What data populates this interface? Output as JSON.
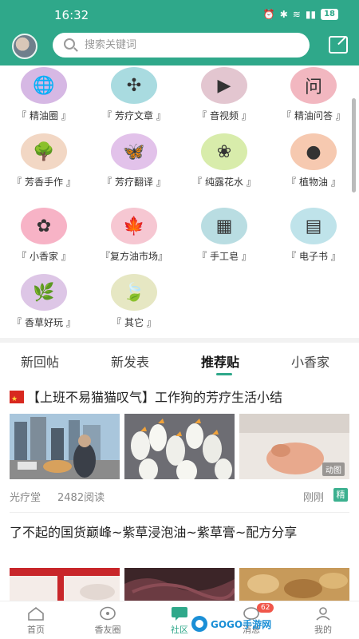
{
  "status_bar": {
    "time": "16:32",
    "battery": "18"
  },
  "header": {
    "search_placeholder": "搜索关键词"
  },
  "categories": [
    {
      "label": "『 精油圈 』",
      "icon": "globe-icon",
      "color": "#d6b8e4"
    },
    {
      "label": "『 芳疗文章 』",
      "icon": "windmill-icon",
      "color": "#a9dbe0"
    },
    {
      "label": "『 音视频 』",
      "icon": "video-icon",
      "color": "#e3c6d0"
    },
    {
      "label": "『 精油问答 』",
      "icon": "question-icon",
      "color": "#f2b7c0"
    },
    {
      "label": "『 芳香手作 』",
      "icon": "tree-icon",
      "color": "#f2d7c4"
    },
    {
      "label": "『 芳疗翻译 』",
      "icon": "butterfly-icon",
      "color": "#e2c2ea"
    },
    {
      "label": "『 纯露花水 』",
      "icon": "flower-icon",
      "color": "#d8ecab"
    },
    {
      "label": "『 植物油 』",
      "icon": "nut-icon",
      "color": "#f6c9b0"
    },
    {
      "label": "『 小香家 』",
      "icon": "rose-icon",
      "color": "#f7b3c6"
    },
    {
      "label": "『复方油市场』",
      "icon": "leaf-icon",
      "color": "#f6c7d2"
    },
    {
      "label": "『 手工皂 』",
      "icon": "soap-icon",
      "color": "#b9dde2"
    },
    {
      "label": "『 电子书 』",
      "icon": "books-icon",
      "color": "#bfe3ea"
    },
    {
      "label": "『 香草好玩 』",
      "icon": "herb-icon",
      "color": "#ddc6e6"
    },
    {
      "label": "『 其它 』",
      "icon": "green-leaf-icon",
      "color": "#e6e7c3"
    }
  ],
  "tabs": [
    {
      "label": "新回帖"
    },
    {
      "label": "新发表"
    },
    {
      "label": "推荐贴",
      "active": true
    },
    {
      "label": "小香家"
    }
  ],
  "posts": [
    {
      "title": "【上班不易猫猫叹气】工作狗的芳疗生活小结",
      "author": "光疗堂",
      "reads": "2482阅读",
      "time": "刚刚",
      "badge": "精",
      "image_badge": "动图"
    },
    {
      "title": "了不起的国货巅峰~紫草浸泡油~紫草膏~配方分享"
    }
  ],
  "nav": [
    {
      "label": "首页",
      "icon": "home-icon"
    },
    {
      "label": "香友圈",
      "icon": "chat-icon"
    },
    {
      "label": "社区",
      "icon": "community-icon",
      "active": true
    },
    {
      "label": "消息",
      "icon": "message-icon"
    },
    {
      "label": "我的",
      "icon": "profile-icon"
    }
  ],
  "message_count": "62",
  "watermark": "GOGO手游网",
  "colors": {
    "brand": "#2fa88a",
    "badge_red": "#f0564a"
  }
}
